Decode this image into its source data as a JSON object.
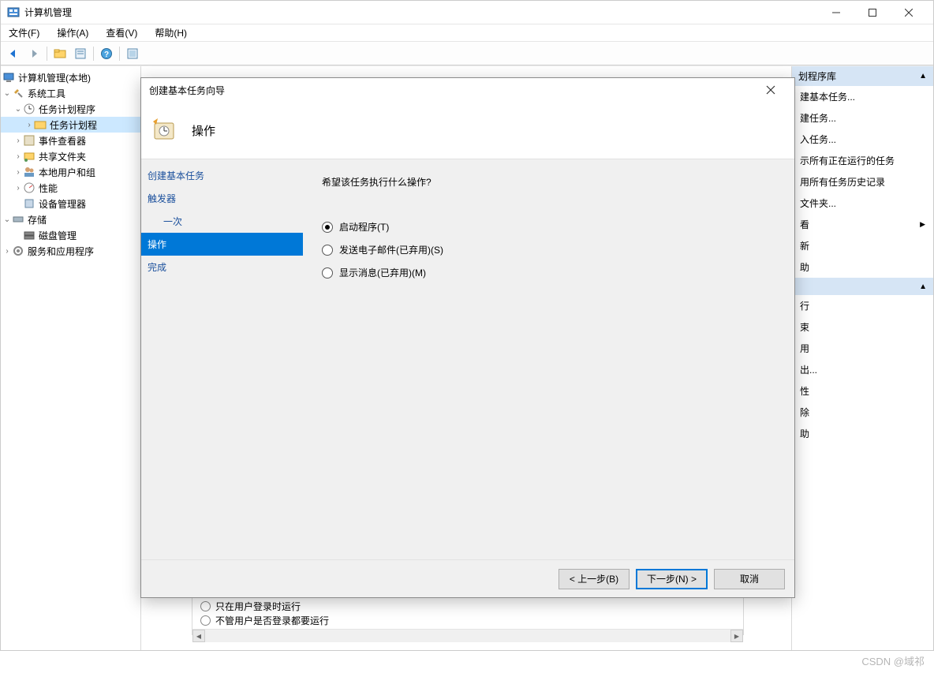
{
  "window": {
    "title": "计算机管理"
  },
  "menubar": {
    "file": "文件(F)",
    "action": "操作(A)",
    "view": "查看(V)",
    "help": "帮助(H)"
  },
  "tree": {
    "root": "计算机管理(本地)",
    "systools": "系统工具",
    "tasksched": "任务计划程序",
    "taskschedlib": "任务计划程",
    "eventviewer": "事件查看器",
    "sharedfolders": "共享文件夹",
    "localusers": "本地用户和组",
    "perf": "性能",
    "devmgr": "设备管理器",
    "storage": "存储",
    "diskmgmt": "磁盘管理",
    "services": "服务和应用程序"
  },
  "actions": {
    "header": "划程序库",
    "items": [
      "建基本任务...",
      "建任务...",
      "入任务...",
      "示所有正在运行的任务",
      "用所有任务历史记录",
      "文件夹...",
      "看",
      "新",
      "助"
    ],
    "group2": [
      "行",
      "束",
      "用",
      "出...",
      "性",
      "除",
      "助"
    ]
  },
  "bottom": {
    "opt1": "只在用户登录时运行",
    "opt2": "不管用户是否登录都要运行"
  },
  "dialog": {
    "title": "创建基本任务向导",
    "heading": "操作",
    "steps": {
      "s1": "创建基本任务",
      "s2": "触发器",
      "s2a": "一次",
      "s3": "操作",
      "s4": "完成"
    },
    "question": "希望该任务执行什么操作?",
    "options": {
      "o1": "启动程序(T)",
      "o2": "发送电子邮件(已弃用)(S)",
      "o3": "显示消息(已弃用)(M)"
    },
    "buttons": {
      "back": "< 上一步(B)",
      "next": "下一步(N) >",
      "cancel": "取消"
    }
  },
  "watermark": "CSDN @域祁"
}
